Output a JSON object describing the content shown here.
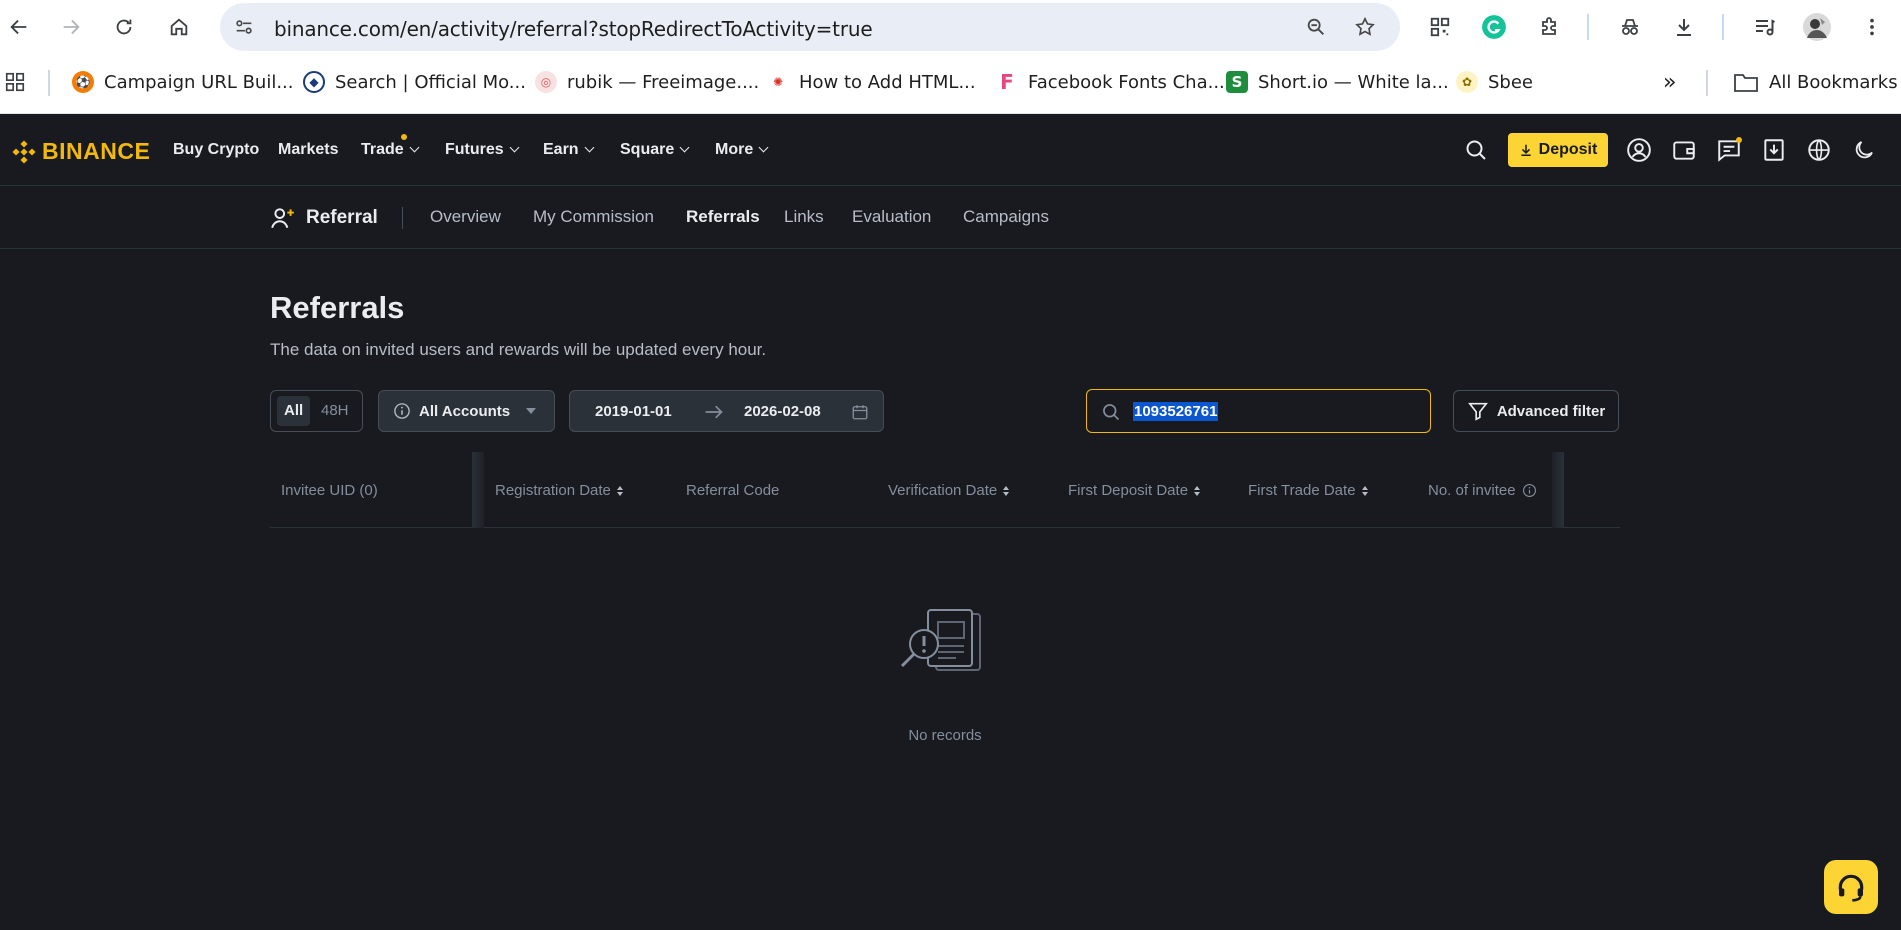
{
  "browser": {
    "url": "binance.com/en/activity/referral?stopRedirectToActivity=true",
    "bookmarks": [
      {
        "label": "Campaign URL Buil..."
      },
      {
        "label": "Search | Official Mo..."
      },
      {
        "label": "rubik — Freeimage...."
      },
      {
        "label": "How to Add HTML..."
      },
      {
        "label": "Facebook Fonts Cha..."
      },
      {
        "label": "Short.io — White la..."
      },
      {
        "label": "Sbee"
      }
    ],
    "all_bookmarks": "All Bookmarks",
    "overflow": "»"
  },
  "header": {
    "logo": "BINANCE",
    "menu": [
      "Buy Crypto",
      "Markets",
      "Trade",
      "Futures",
      "Earn",
      "Square",
      "More"
    ],
    "deposit": "Deposit"
  },
  "subnav": {
    "title": "Referral",
    "items": [
      "Overview",
      "My Commission",
      "Referrals",
      "Links",
      "Evaluation",
      "Campaigns"
    ],
    "active": "Referrals"
  },
  "main": {
    "title": "Referrals",
    "subtitle": "The data on invited users and rewards will be updated every hour.",
    "range_tabs": [
      "All",
      "48H"
    ],
    "account_select": "All Accounts",
    "date_from": "2019-01-01",
    "date_to": "2026-02-08",
    "search_value": "1093526761",
    "advanced_filter": "Advanced filter"
  },
  "table": {
    "columns": [
      "Invitee UID (0)",
      "Registration Date",
      "Referral Code",
      "Verification Date",
      "First Deposit Date",
      "First Trade Date",
      "No. of invitee"
    ],
    "empty_text": "No records"
  },
  "colors": {
    "accent": "#f0b90b",
    "background": "#181a20",
    "selection": "#0b57d0"
  }
}
